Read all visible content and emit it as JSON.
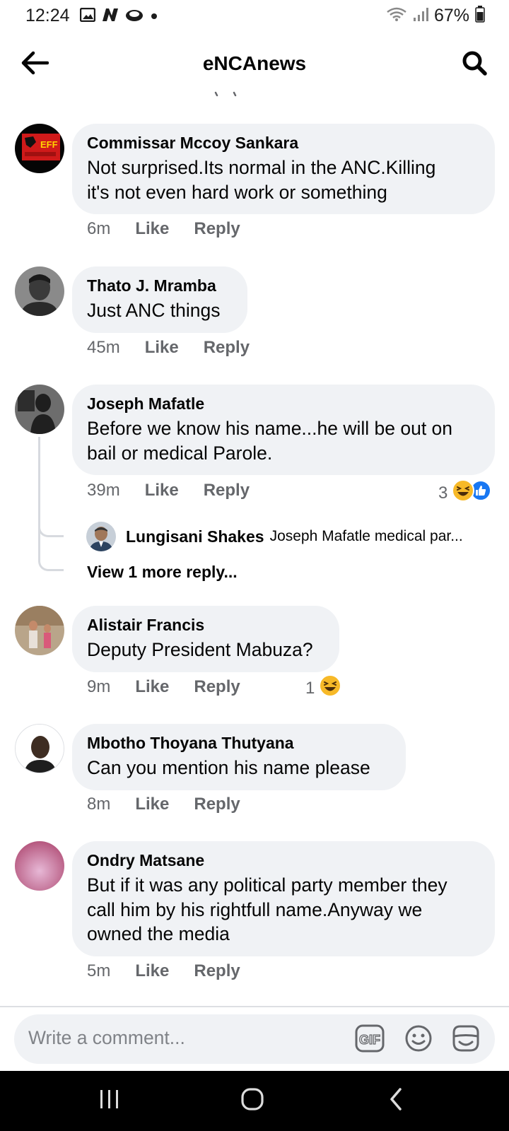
{
  "status_bar": {
    "time": "12:24",
    "battery": "67%",
    "left_icons": [
      "image-icon",
      "n-icon",
      "cloud-icon",
      "dot-icon"
    ],
    "right_icons": [
      "wifi-icon",
      "signal-icon",
      "battery-icon"
    ]
  },
  "header": {
    "title": "eNCAnews",
    "back_icon": "arrow-left-icon",
    "search_icon": "search-icon"
  },
  "comments": [
    {
      "author": "Commissar Mccoy Sankara",
      "text_lines": [
        "Not surprised.Its normal in the ANC.Killing",
        "it's not even hard work or something"
      ],
      "time": "6m",
      "like": "Like",
      "reply": "Reply",
      "avatar_badge": "EFF"
    },
    {
      "author": "Thato J. Mramba",
      "text_lines": [
        "Just ANC things"
      ],
      "time": "45m",
      "like": "Like",
      "reply": "Reply"
    },
    {
      "author": "Joseph Mafatle",
      "text_lines": [
        "Before we know his name...he will be out on",
        "bail or medical Parole."
      ],
      "time": "39m",
      "like": "Like",
      "reply": "Reply",
      "reaction_count": "3",
      "reactions": [
        "haha-icon",
        "like-icon"
      ],
      "reply_preview": {
        "author": "Lungisani Shakes",
        "text": "Joseph Mafatle medical par..."
      },
      "view_more": "View 1 more reply..."
    },
    {
      "author": "Alistair Francis",
      "text_lines": [
        "Deputy President Mabuza?"
      ],
      "time": "9m",
      "like": "Like",
      "reply": "Reply",
      "reaction_count": "1",
      "reactions": [
        "haha-icon"
      ]
    },
    {
      "author": "Mbotho Thoyana Thutyana",
      "text_lines": [
        "Can you mention his name please"
      ],
      "time": "8m",
      "like": "Like",
      "reply": "Reply"
    },
    {
      "author": "Ondry Matsane",
      "text_lines": [
        "But if it was any political party member they",
        "call him by his rightfull name.Anyway we",
        "owned the media"
      ],
      "time": "5m",
      "like": "Like",
      "reply": "Reply"
    }
  ],
  "composer": {
    "placeholder": "Write a comment...",
    "icons": [
      "gif-icon",
      "emoji-icon",
      "sticker-icon"
    ]
  },
  "nav_bar": {
    "icons": [
      "recent-apps-icon",
      "home-icon",
      "back-icon"
    ]
  },
  "colors": {
    "bubble": "#f0f2f5",
    "meta_text": "#65676b",
    "like_blue": "#1877f2",
    "haha_yellow": "#f7b928"
  }
}
